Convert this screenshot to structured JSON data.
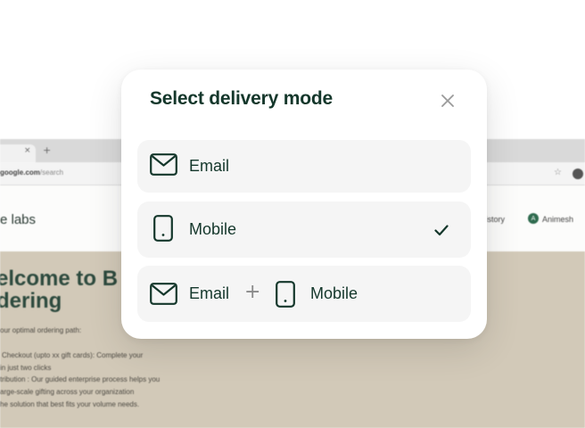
{
  "background": {
    "tab_close": "×",
    "tab_new": "+",
    "url": "google.com",
    "url_path": "/search",
    "logo_text": "e labs",
    "nav_history": "History",
    "user_initial": "A",
    "user_name": "Animesh",
    "heading_line1": "elcome to B",
    "heading_line2": "dering",
    "para1": "our optimal ordering path:",
    "para2": "Checkout (upto xx gift cards): Complete your",
    "para3": "in just two clicks",
    "para4": "tribution : Our guided enterprise process helps you",
    "para5": "arge-scale gifting across your organization",
    "para6": "he solution that best fits your volume needs."
  },
  "modal": {
    "title": "Select delivery mode",
    "close_icon": "close-icon",
    "options": [
      {
        "label": "Email",
        "icon": "mail-icon",
        "selected": false
      },
      {
        "label": "Mobile",
        "icon": "phone-icon",
        "selected": true
      },
      {
        "label_a": "Email",
        "separator": "+",
        "label_b": "Mobile",
        "icon_a": "mail-icon",
        "icon_b": "phone-icon",
        "selected": false
      }
    ]
  },
  "colors": {
    "primary_text": "#14372b",
    "option_bg": "#f5f5f5",
    "modal_bg": "#ffffff",
    "muted": "#8a8a8a"
  }
}
